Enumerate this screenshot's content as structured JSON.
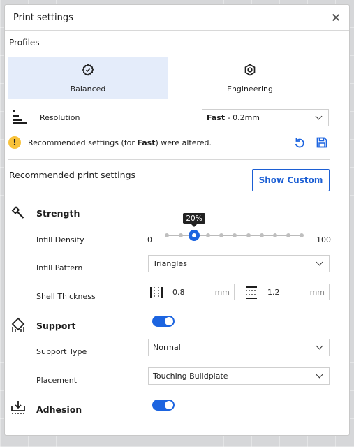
{
  "window": {
    "title": "Print settings"
  },
  "profiles": {
    "label": "Profiles",
    "items": [
      {
        "name": "Balanced",
        "icon": "gear-badge-icon",
        "selected": true
      },
      {
        "name": "Engineering",
        "icon": "hex-nut-icon",
        "selected": false
      }
    ]
  },
  "resolution": {
    "label": "Resolution",
    "value_bold": "Fast",
    "value_rest": " - 0.2mm"
  },
  "warning": {
    "prefix": "Recommended settings (for ",
    "bold": "Fast",
    "suffix": ") were altered."
  },
  "recommended": {
    "title": "Recommended print settings",
    "custom_button": "Show Custom"
  },
  "strength": {
    "title": "Strength",
    "infill_density": {
      "label": "Infill Density",
      "min": "0",
      "max": "100",
      "value": 20,
      "tooltip": "20%"
    },
    "infill_pattern": {
      "label": "Infill Pattern",
      "value": "Triangles"
    },
    "shell_thickness": {
      "label": "Shell Thickness",
      "wall": "0.8",
      "top_bottom": "1.2",
      "unit": "mm"
    }
  },
  "support": {
    "title": "Support",
    "enabled": true,
    "type": {
      "label": "Support Type",
      "value": "Normal"
    },
    "placement": {
      "label": "Placement",
      "value": "Touching Buildplate"
    }
  },
  "adhesion": {
    "title": "Adhesion",
    "enabled": true
  },
  "colors": {
    "accent": "#1c64e0",
    "selected_bg": "#e4ecfa",
    "warning": "#f8c23a"
  }
}
